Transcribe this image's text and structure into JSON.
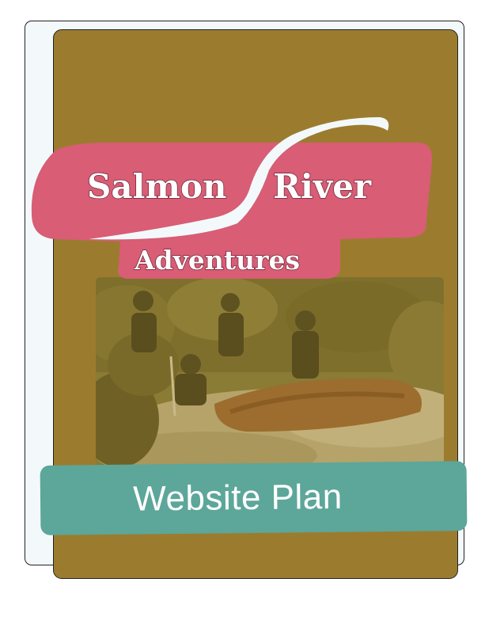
{
  "cover": {
    "title_word_1": "Salmon",
    "title_word_2": "River",
    "subtitle": "Adventures",
    "document_type": "Website Plan"
  },
  "colors": {
    "cover_background": "#9b7c2f",
    "title_banner": "#d85d75",
    "plan_bar": "#5da69a",
    "back_card": "#f3f9fb"
  },
  "photo": {
    "description_icon": "rafting-photo"
  }
}
